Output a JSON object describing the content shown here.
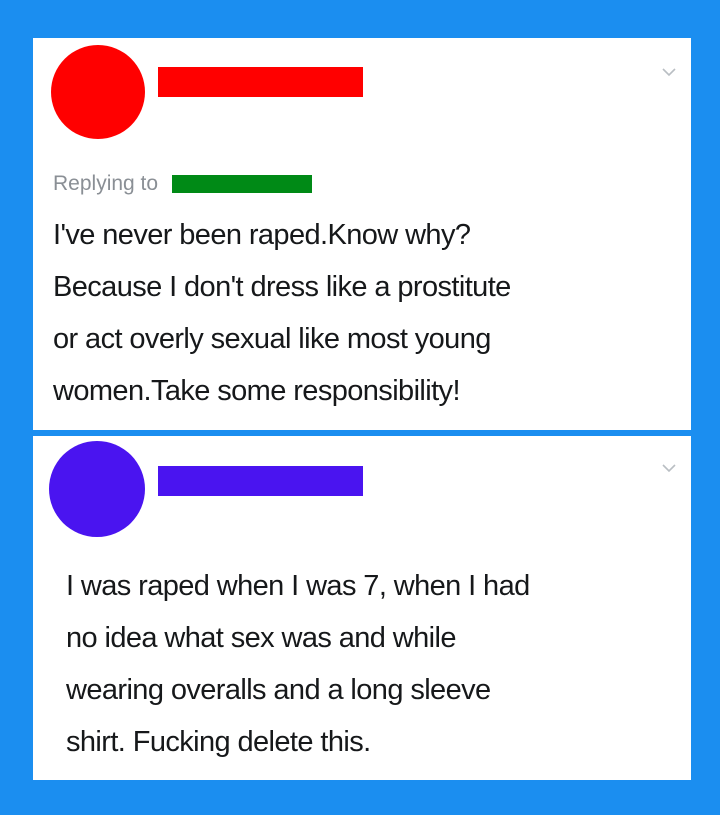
{
  "colors": {
    "background": "#1b8ef0",
    "card": "#ffffff",
    "avatar_1": "#ff0000",
    "name_redaction_1": "#ff0000",
    "reply_redaction": "#008a16",
    "avatar_2": "#4a14f0",
    "name_redaction_2": "#4a14f0"
  },
  "tweet_1": {
    "replying_to_label": "Replying to",
    "text": "I've never been raped.Know why?\nBecause I don't dress like a prostitute\nor act overly sexual like most young\nwomen.Take some responsibility!",
    "menu_icon": "chevron-down-icon"
  },
  "tweet_2": {
    "text": "I was raped when I was 7, when I had\nno idea what sex was and while\nwearing overalls and a long sleeve\nshirt. Fucking delete this.",
    "menu_icon": "chevron-down-icon"
  }
}
